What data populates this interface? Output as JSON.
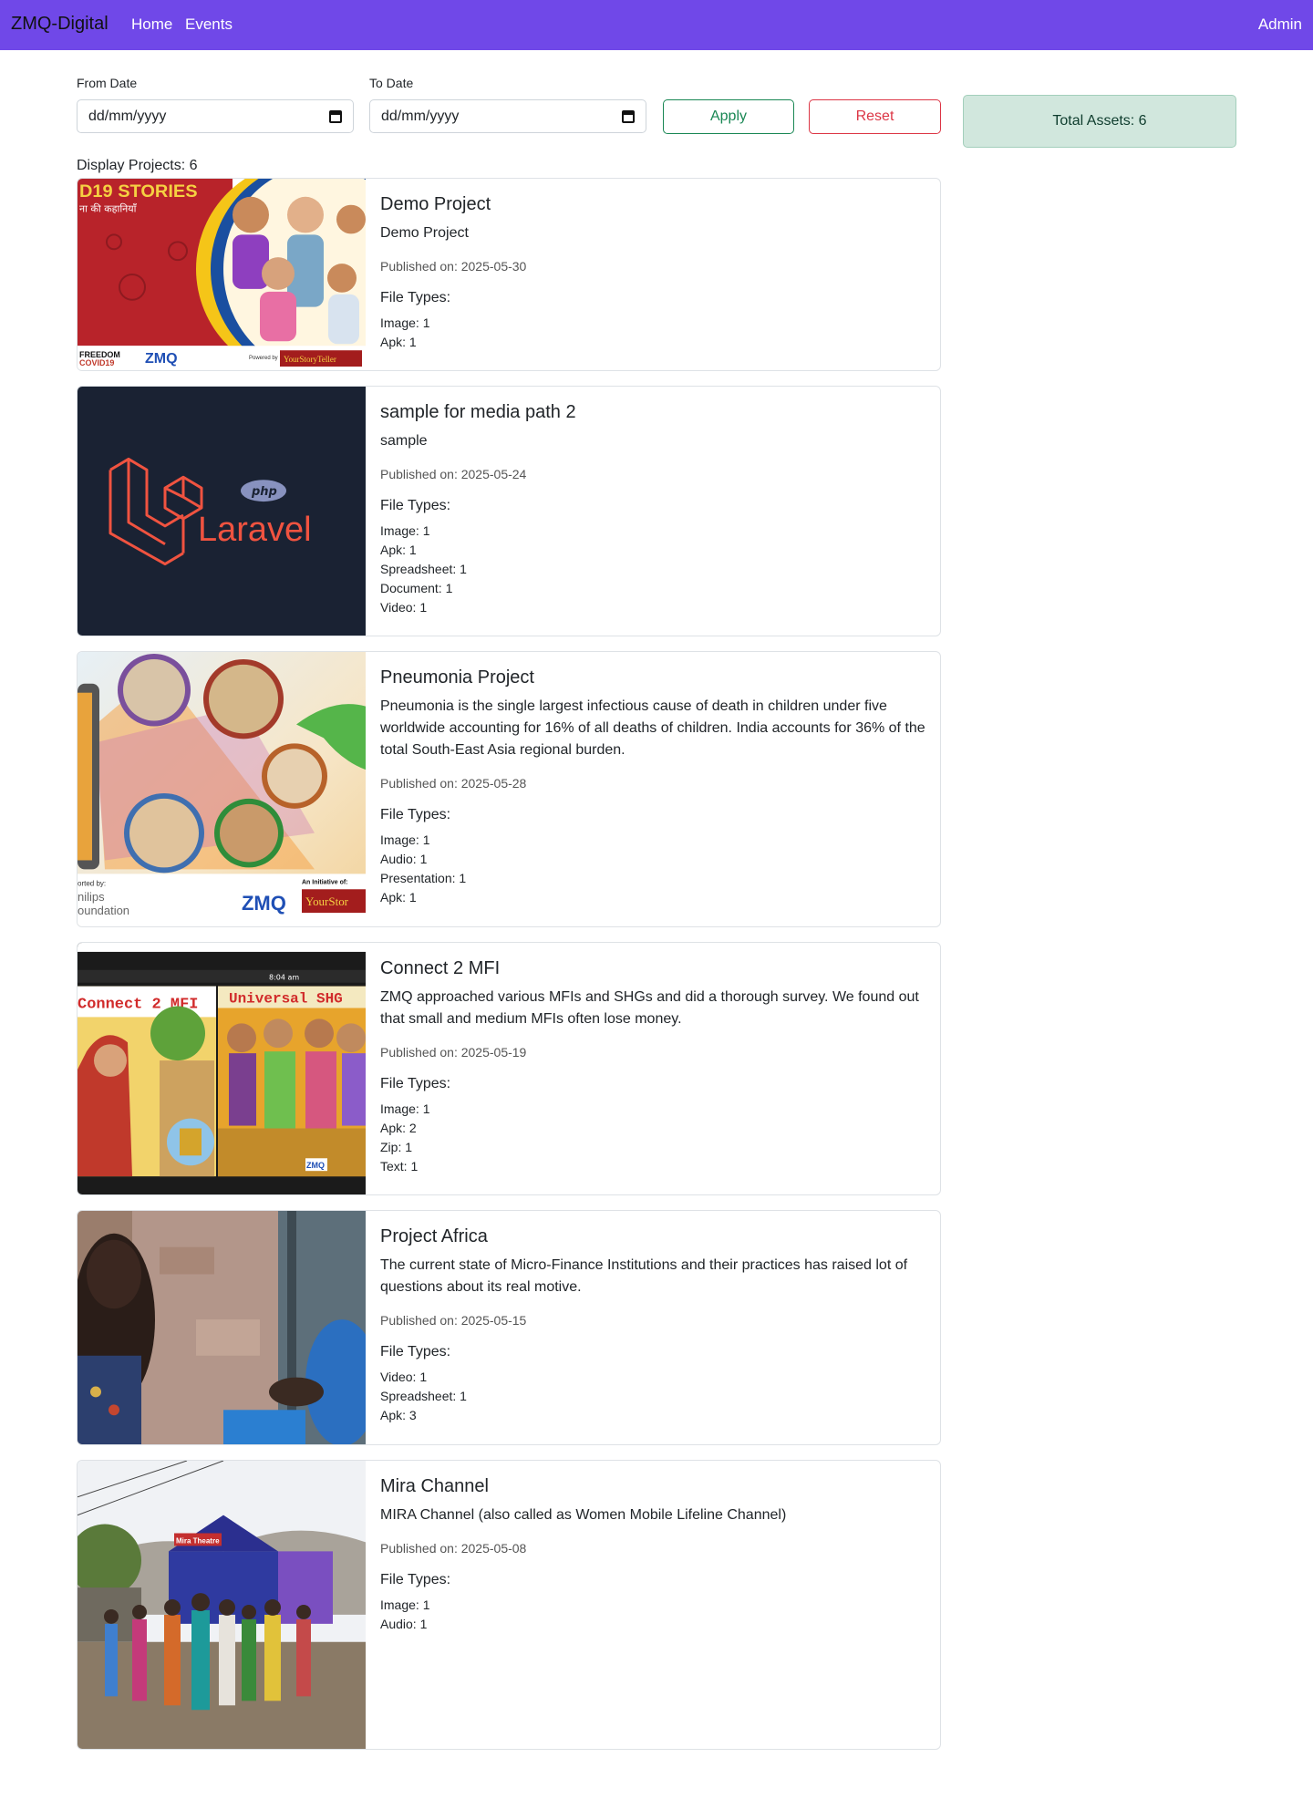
{
  "navbar": {
    "brand": "ZMQ-Digital",
    "links": [
      "Home",
      "Events"
    ],
    "admin": "Admin",
    "bg_color": "#7048e8"
  },
  "filters": {
    "from_label": "From Date",
    "from_placeholder": "dd/mm/yyyy",
    "to_label": "To Date",
    "to_placeholder": "dd/mm/yyyy",
    "apply_label": "Apply",
    "reset_label": "Reset",
    "total_assets": "Total Assets: 6"
  },
  "display_count": "Display Projects: 6",
  "projects": [
    {
      "title": "Demo Project",
      "description": "Demo Project",
      "published": "Published on: 2025-05-30",
      "file_types_label": "File Types:",
      "file_types": [
        "Image: 1",
        "Apk: 1"
      ],
      "image_label": "covid19-stories-poster"
    },
    {
      "title": "sample for media path 2",
      "description": "sample",
      "published": "Published on: 2025-05-24",
      "file_types_label": "File Types:",
      "file_types": [
        "Image: 1",
        "Apk: 1",
        "Spreadsheet: 1",
        "Document: 1",
        "Video: 1"
      ],
      "image_label": "laravel-logo"
    },
    {
      "title": "Pneumonia Project",
      "description": "Pneumonia is the single largest infectious cause of death in children under five worldwide accounting for 16% of all deaths of children. India accounts for 36% of the total South-East Asia regional burden.",
      "published": "Published on: 2025-05-28",
      "file_types_label": "File Types:",
      "file_types": [
        "Image: 1",
        "Audio: 1",
        "Presentation: 1",
        "Apk: 1"
      ],
      "image_label": "pneumonia-illustration"
    },
    {
      "title": "Connect 2 MFI",
      "description": "ZMQ approached various MFIs and SHGs and did a thorough survey. We found out that small and medium MFIs often lose money.",
      "published": "Published on: 2025-05-19",
      "file_types_label": "File Types:",
      "file_types": [
        "Image: 1",
        "Apk: 2",
        "Zip: 1",
        "Text: 1"
      ],
      "image_label": "connect-2-mfi-screenshot"
    },
    {
      "title": "Project Africa",
      "description": "The current state of Micro-Finance Institutions and their practices has raised lot of questions about its real motive.",
      "published": "Published on: 2025-05-15",
      "file_types_label": "File Types:",
      "file_types": [
        "Video: 1",
        "Spreadsheet: 1",
        "Apk: 3"
      ],
      "image_label": "project-africa-photo"
    },
    {
      "title": "Mira Channel",
      "description": "MIRA Channel (also called as Women Mobile Lifeline Channel)",
      "published": "Published on: 2025-05-08",
      "file_types_label": "File Types:",
      "file_types": [
        "Image: 1",
        "Audio: 1"
      ],
      "image_label": "mira-channel-photo"
    }
  ],
  "image_text": {
    "covid": [
      "D19 STORIES",
      "ना की कहानियाँ",
      "FREEDOM",
      "COVID19",
      "ZMQ",
      "Powered by",
      "YourStoryTeller"
    ],
    "laravel": [
      "php",
      "Laravel"
    ],
    "pneumonia": [
      "orted by:",
      "nilips",
      "oundation",
      "ZMQ",
      "An Initiative of:",
      "YourStor"
    ],
    "mfi": [
      "Connect 2 MFI",
      "Universal SHG",
      "8:04 am",
      "ZMQ"
    ],
    "mira": [
      "Mira Theatre"
    ]
  }
}
